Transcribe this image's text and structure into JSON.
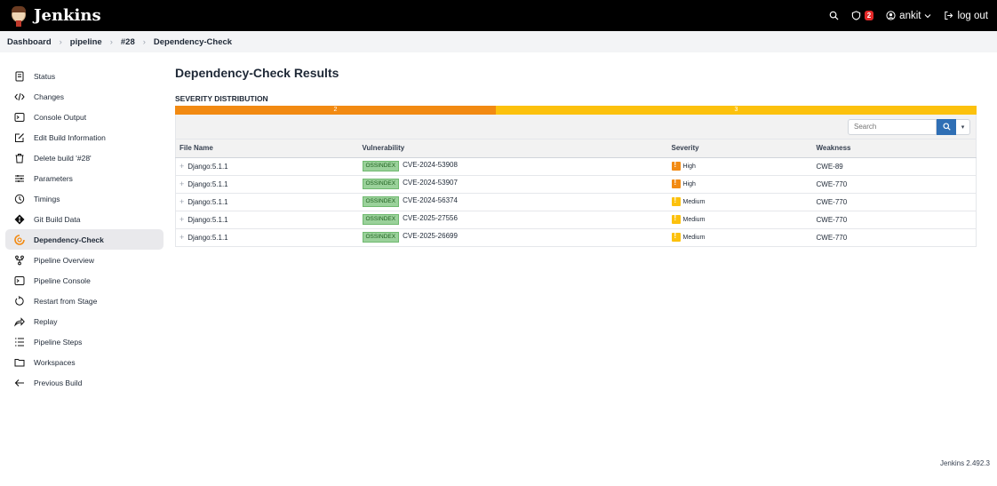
{
  "header": {
    "brand": "Jenkins",
    "notification_count": "2",
    "user": "ankit",
    "logout": "log out"
  },
  "breadcrumb": [
    "Dashboard",
    "pipeline",
    "#28",
    "Dependency-Check"
  ],
  "sidebar": {
    "items": [
      {
        "label": "Status",
        "icon": "status-icon"
      },
      {
        "label": "Changes",
        "icon": "code-icon"
      },
      {
        "label": "Console Output",
        "icon": "terminal-icon"
      },
      {
        "label": "Edit Build Information",
        "icon": "edit-icon"
      },
      {
        "label": "Delete build '#28'",
        "icon": "trash-icon"
      },
      {
        "label": "Parameters",
        "icon": "sliders-icon"
      },
      {
        "label": "Timings",
        "icon": "clock-icon"
      },
      {
        "label": "Git Build Data",
        "icon": "git-icon"
      },
      {
        "label": "Dependency-Check",
        "icon": "dependency-check-icon",
        "active": true
      },
      {
        "label": "Pipeline Overview",
        "icon": "pipeline-icon"
      },
      {
        "label": "Pipeline Console",
        "icon": "terminal-icon"
      },
      {
        "label": "Restart from Stage",
        "icon": "restart-icon"
      },
      {
        "label": "Replay",
        "icon": "replay-icon"
      },
      {
        "label": "Pipeline Steps",
        "icon": "steps-icon"
      },
      {
        "label": "Workspaces",
        "icon": "folder-icon"
      },
      {
        "label": "Previous Build",
        "icon": "arrow-left-icon"
      }
    ]
  },
  "main": {
    "title": "Dependency-Check Results",
    "severity_title": "SEVERITY DISTRIBUTION",
    "severity": {
      "high": {
        "count": "2",
        "fraction": 0.4,
        "color": "#f28a12"
      },
      "medium": {
        "count": "3",
        "fraction": 0.6,
        "color": "#fcc10d"
      }
    },
    "search_placeholder": "Search",
    "columns": [
      "File Name",
      "Vulnerability",
      "Severity",
      "Weakness"
    ],
    "rows": [
      {
        "file": "Django:5.1.1",
        "source": "OSSINDEX",
        "cve": "CVE-2024-53908",
        "severity": "High",
        "weakness": "CWE-89"
      },
      {
        "file": "Django:5.1.1",
        "source": "OSSINDEX",
        "cve": "CVE-2024-53907",
        "severity": "High",
        "weakness": "CWE-770"
      },
      {
        "file": "Django:5.1.1",
        "source": "OSSINDEX",
        "cve": "CVE-2024-56374",
        "severity": "Medium",
        "weakness": "CWE-770"
      },
      {
        "file": "Django:5.1.1",
        "source": "OSSINDEX",
        "cve": "CVE-2025-27556",
        "severity": "Medium",
        "weakness": "CWE-770"
      },
      {
        "file": "Django:5.1.1",
        "source": "OSSINDEX",
        "cve": "CVE-2025-26699",
        "severity": "Medium",
        "weakness": "CWE-770"
      }
    ]
  },
  "footer": "Jenkins 2.492.3"
}
